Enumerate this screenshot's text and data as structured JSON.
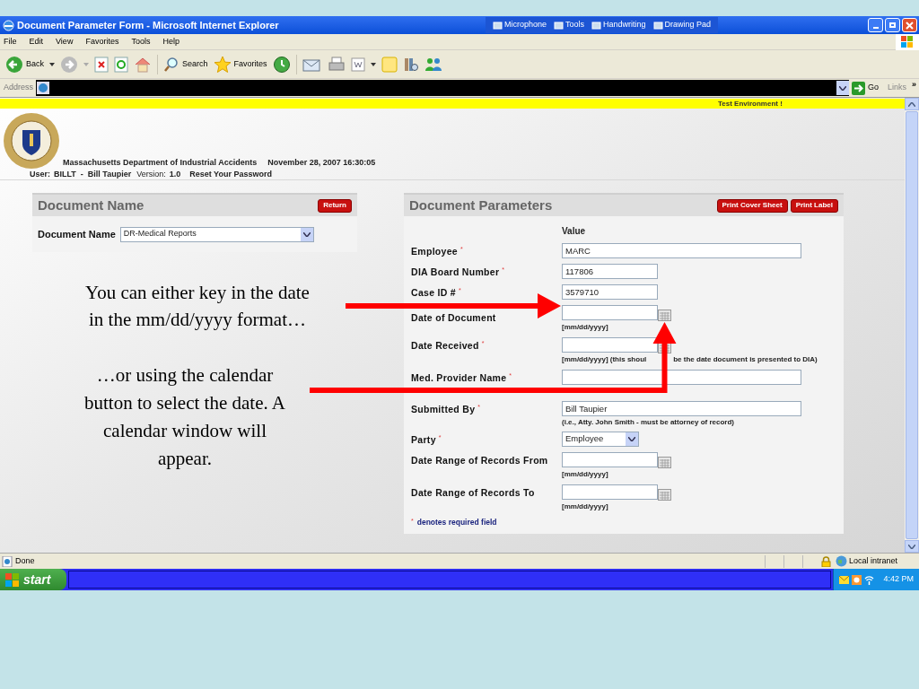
{
  "window": {
    "title": "Document Parameter Form - Microsoft Internet Explorer"
  },
  "language_bar": [
    "Microphone",
    "Tools",
    "Handwriting",
    "Drawing Pad"
  ],
  "menu": [
    "File",
    "Edit",
    "View",
    "Favorites",
    "Tools",
    "Help"
  ],
  "toolbar": {
    "back": "Back",
    "search": "Search",
    "favorites": "Favorites"
  },
  "address_bar": {
    "label": "Address",
    "go": "Go",
    "links": "Links",
    "more": "»"
  },
  "page": {
    "banner": "Test Environment !",
    "header": {
      "org": "Massachusetts Department of Industrial Accidents",
      "datetime": "November 28, 2007 16:30:05",
      "user_label": "User:",
      "user": "BILLT  -  Bill Taupier",
      "version_label": "Version:",
      "version": "1.0",
      "reset_link": "Reset Your Password"
    },
    "document_name_panel": {
      "title": "Document Name",
      "return_button": "Return",
      "label": "Document Name",
      "value": "DR-Medical Reports"
    },
    "parameters_panel": {
      "title": "Document Parameters",
      "buttons": [
        "Print Cover Sheet",
        "Print Label"
      ],
      "value_header": "Value",
      "fields": [
        {
          "kind": "text",
          "label": "Employee",
          "required_mark": "*",
          "value": "MARC"
        },
        {
          "kind": "number",
          "label": "DIA Board Number",
          "required_mark": "*",
          "value": "117806"
        },
        {
          "kind": "number",
          "label": "Case ID #",
          "required_mark": "*",
          "value": "3579710"
        },
        {
          "kind": "date",
          "label": "Date of Document",
          "hint": "[mm/dd/yyyy]"
        },
        {
          "kind": "date",
          "label": "Date Received",
          "required_mark": "*",
          "hint": "[mm/dd/yyyy] (this shoul",
          "hint_after": "be the date document is presented to DIA)"
        },
        {
          "kind": "text",
          "label": "Med. Provider Name",
          "required_mark": "*"
        },
        {
          "kind": "text",
          "label": "Submitted By",
          "required_mark": "*",
          "value": "Bill Taupier",
          "hint": "(i.e., Atty. John Smith - must be attorney of record)"
        },
        {
          "kind": "select",
          "label": "Party",
          "required_mark": "*",
          "value": "Employee"
        },
        {
          "kind": "date",
          "label": "Date Range of Records From",
          "hint": "[mm/dd/yyyy]"
        },
        {
          "kind": "date",
          "label": "Date Range of Records To",
          "hint": "[mm/dd/yyyy]"
        }
      ],
      "footnote": {
        "mark": "*",
        "text": "denotes required field"
      }
    }
  },
  "annotations": [
    "You can either key in the date in the mm/dd/yyyy format…",
    "…or using the calendar button to select the date. A calendar window will appear."
  ],
  "status_bar": {
    "text": "Done",
    "zone": "Local intranet"
  },
  "taskbar": {
    "start": "start",
    "clock": "4:42 PM"
  }
}
